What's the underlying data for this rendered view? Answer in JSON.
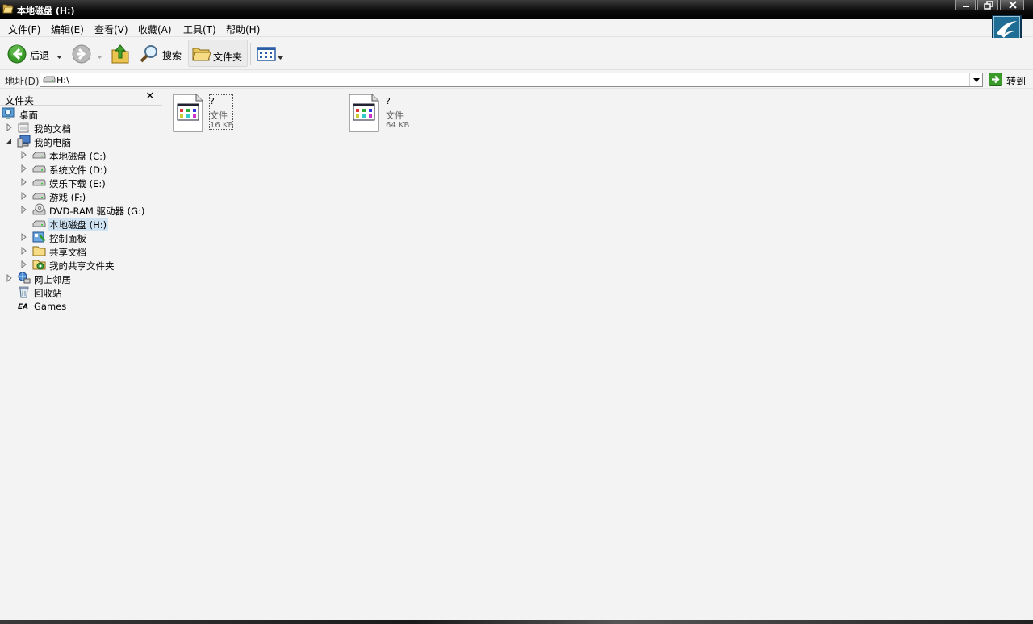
{
  "window": {
    "title": "本地磁盘 (H:)",
    "icon": "open-folder-icon",
    "controls": [
      "minimize-icon",
      "restore-icon",
      "close-icon"
    ]
  },
  "menubar": {
    "items": [
      "文件(F)",
      "编辑(E)",
      "查看(V)",
      "收藏(A)",
      "工具(T)",
      "帮助(H)"
    ]
  },
  "toolbar": {
    "back_label": "后退",
    "search_label": "搜索",
    "folders_label": "文件夹",
    "icons": [
      "back-arrow-icon",
      "forward-arrow-icon",
      "up-folder-icon",
      "search-magnifier-icon",
      "folders-icon",
      "views-icon"
    ]
  },
  "address": {
    "label": "地址(D)",
    "value": "H:\\",
    "go_label": "转到",
    "drive_icon": "drive-icon"
  },
  "folder_pane": {
    "title": "文件夹",
    "close_glyph": "✕",
    "tree": [
      {
        "label": "桌面",
        "icon": "desktop-icon",
        "expander": "none"
      },
      {
        "label": "我的文档",
        "icon": "my-documents-icon",
        "expander": "collapsed"
      },
      {
        "label": "我的电脑",
        "icon": "my-computer-icon",
        "expander": "expanded"
      },
      {
        "label": "本地磁盘 (C:)",
        "icon": "drive-icon",
        "expander": "collapsed"
      },
      {
        "label": "系统文件 (D:)",
        "icon": "drive-icon",
        "expander": "collapsed"
      },
      {
        "label": "娱乐下载 (E:)",
        "icon": "drive-icon",
        "expander": "collapsed"
      },
      {
        "label": "游戏 (F:)",
        "icon": "drive-icon",
        "expander": "collapsed"
      },
      {
        "label": "DVD-RAM 驱动器 (G:)",
        "icon": "dvd-drive-icon",
        "expander": "collapsed"
      },
      {
        "label": "本地磁盘 (H:)",
        "icon": "drive-icon",
        "expander": "none",
        "selected": true
      },
      {
        "label": "控制面板",
        "icon": "control-panel-icon",
        "expander": "collapsed"
      },
      {
        "label": "共享文档",
        "icon": "shared-folder-icon",
        "expander": "collapsed"
      },
      {
        "label": "我的共享文件夹",
        "icon": "shared-network-folder-icon",
        "expander": "collapsed"
      },
      {
        "label": "网上邻居",
        "icon": "network-icon",
        "expander": "collapsed"
      },
      {
        "label": "回收站",
        "icon": "recycle-bin-icon",
        "expander": "none"
      },
      {
        "label": "Games",
        "icon": "ea-logo-icon",
        "expander": "none"
      }
    ]
  },
  "files": [
    {
      "name": "?",
      "type": "文件",
      "size": "16 KB",
      "focused": true,
      "icon": "application-file-icon"
    },
    {
      "name": "?",
      "type": "文件",
      "size": "64 KB",
      "focused": false,
      "icon": "application-file-icon"
    }
  ]
}
